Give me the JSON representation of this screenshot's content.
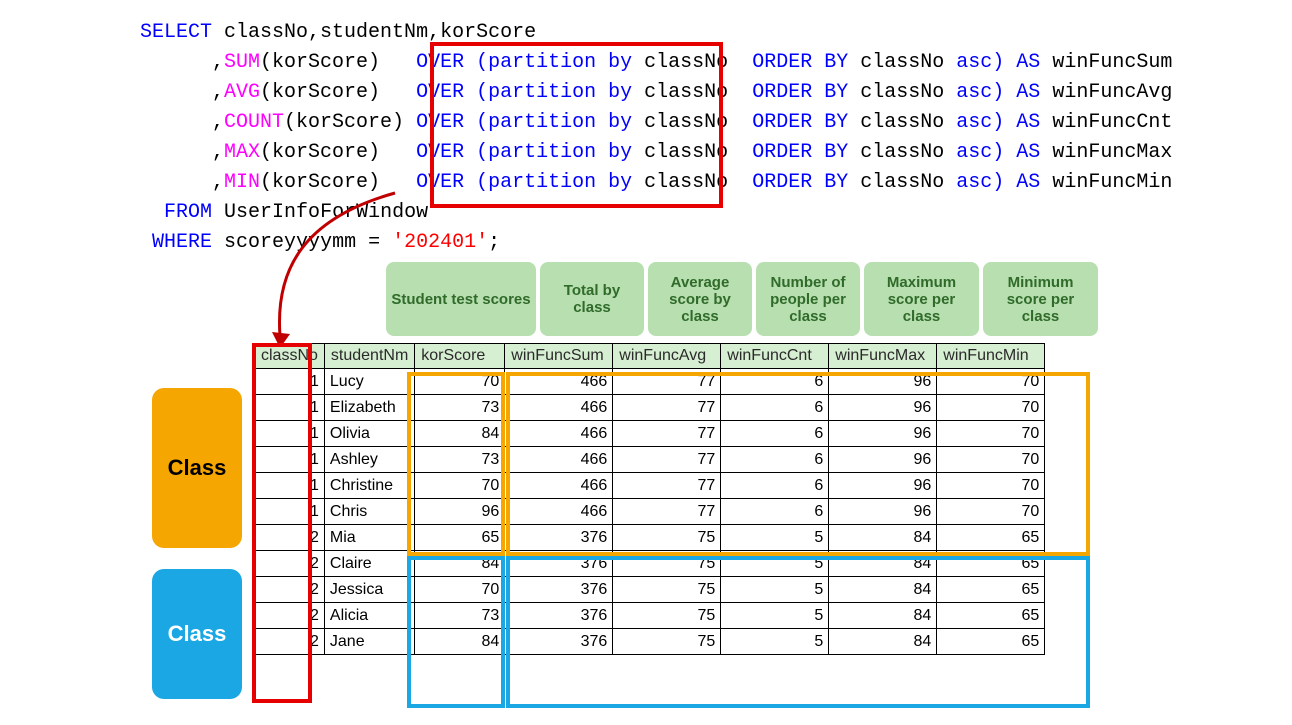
{
  "sql": {
    "select": "SELECT",
    "cols": "classNo,studentNm,korScore",
    "lines": [
      {
        "fn": "SUM",
        "arg": "(korScore)",
        "over": "OVER",
        "part1": "(partition by",
        "pcol": "classNo",
        "ord": "ORDER BY",
        "ocol": "classNo",
        "dir": "asc)",
        "as": "AS",
        "alias": "winFuncSum"
      },
      {
        "fn": "AVG",
        "arg": "(korScore)",
        "over": "OVER",
        "part1": "(partition by",
        "pcol": "classNo",
        "ord": "ORDER BY",
        "ocol": "classNo",
        "dir": "asc)",
        "as": "AS",
        "alias": "winFuncAvg"
      },
      {
        "fn": "COUNT",
        "arg": "(korScore)",
        "over": "OVER",
        "part1": "(partition by",
        "pcol": "classNo",
        "ord": "ORDER BY",
        "ocol": "classNo",
        "dir": "asc)",
        "as": "AS",
        "alias": "winFuncCnt"
      },
      {
        "fn": "MAX",
        "arg": "(korScore)",
        "over": "OVER",
        "part1": "(partition by",
        "pcol": "classNo",
        "ord": "ORDER BY",
        "ocol": "classNo",
        "dir": "asc)",
        "as": "AS",
        "alias": "winFuncMax"
      },
      {
        "fn": "MIN",
        "arg": "(korScore)",
        "over": "OVER",
        "part1": "(partition by",
        "pcol": "classNo",
        "ord": "ORDER BY",
        "ocol": "classNo",
        "dir": "asc)",
        "as": "AS",
        "alias": "winFuncMin"
      }
    ],
    "from": "FROM",
    "table": "UserInfoForWindow",
    "where": "WHERE",
    "wcol": "scoreyyyymm",
    "eq": "=",
    "wval": "'202401'",
    "semi": ";"
  },
  "greenLabels": [
    "Student test scores",
    "Total by class",
    "Average score by class",
    "Number of people per class",
    "Maximum score per class",
    "Minimum score per class"
  ],
  "headers": [
    "classNo",
    "studentNm",
    "korScore",
    "winFuncSum",
    "winFuncAvg",
    "winFuncCnt",
    "winFuncMax",
    "winFuncMin"
  ],
  "rows": [
    {
      "classNo": 1,
      "studentNm": "Lucy",
      "korScore": 70,
      "winFuncSum": 466,
      "winFuncAvg": 77,
      "winFuncCnt": 6,
      "winFuncMax": 96,
      "winFuncMin": 70
    },
    {
      "classNo": 1,
      "studentNm": "Elizabeth",
      "korScore": 73,
      "winFuncSum": 466,
      "winFuncAvg": 77,
      "winFuncCnt": 6,
      "winFuncMax": 96,
      "winFuncMin": 70
    },
    {
      "classNo": 1,
      "studentNm": "Olivia",
      "korScore": 84,
      "winFuncSum": 466,
      "winFuncAvg": 77,
      "winFuncCnt": 6,
      "winFuncMax": 96,
      "winFuncMin": 70
    },
    {
      "classNo": 1,
      "studentNm": "Ashley",
      "korScore": 73,
      "winFuncSum": 466,
      "winFuncAvg": 77,
      "winFuncCnt": 6,
      "winFuncMax": 96,
      "winFuncMin": 70
    },
    {
      "classNo": 1,
      "studentNm": "Christine",
      "korScore": 70,
      "winFuncSum": 466,
      "winFuncAvg": 77,
      "winFuncCnt": 6,
      "winFuncMax": 96,
      "winFuncMin": 70
    },
    {
      "classNo": 1,
      "studentNm": "Chris",
      "korScore": 96,
      "winFuncSum": 466,
      "winFuncAvg": 77,
      "winFuncCnt": 6,
      "winFuncMax": 96,
      "winFuncMin": 70
    },
    {
      "classNo": 2,
      "studentNm": "Mia",
      "korScore": 65,
      "winFuncSum": 376,
      "winFuncAvg": 75,
      "winFuncCnt": 5,
      "winFuncMax": 84,
      "winFuncMin": 65
    },
    {
      "classNo": 2,
      "studentNm": "Claire",
      "korScore": 84,
      "winFuncSum": 376,
      "winFuncAvg": 75,
      "winFuncCnt": 5,
      "winFuncMax": 84,
      "winFuncMin": 65
    },
    {
      "classNo": 2,
      "studentNm": "Jessica",
      "korScore": 70,
      "winFuncSum": 376,
      "winFuncAvg": 75,
      "winFuncCnt": 5,
      "winFuncMax": 84,
      "winFuncMin": 65
    },
    {
      "classNo": 2,
      "studentNm": "Alicia",
      "korScore": 73,
      "winFuncSum": 376,
      "winFuncAvg": 75,
      "winFuncCnt": 5,
      "winFuncMax": 84,
      "winFuncMin": 65
    },
    {
      "classNo": 2,
      "studentNm": "Jane",
      "korScore": 84,
      "winFuncSum": 376,
      "winFuncAvg": 75,
      "winFuncCnt": 5,
      "winFuncMax": 84,
      "winFuncMin": 65
    }
  ],
  "classLabels": {
    "c1": "Class",
    "c2": "Class"
  }
}
